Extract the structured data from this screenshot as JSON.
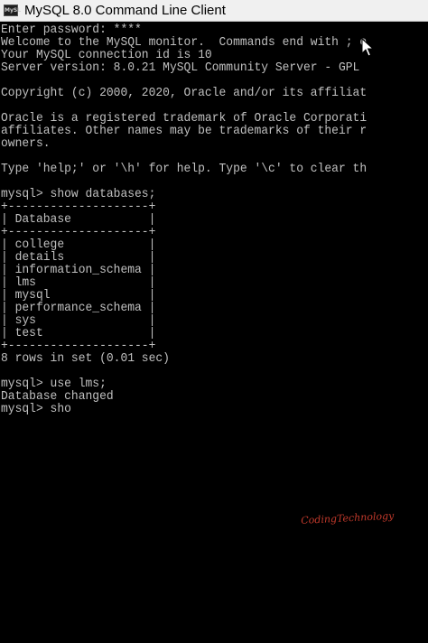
{
  "window": {
    "title": "MySQL 8.0 Command Line Client",
    "icon_label": "MySL",
    "icon": "mysql-console-icon"
  },
  "console": {
    "lines": [
      "Enter password: ****",
      "Welcome to the MySQL monitor.  Commands end with ; o",
      "Your MySQL connection id is 10",
      "Server version: 8.0.21 MySQL Community Server - GPL",
      "",
      "Copyright (c) 2000, 2020, Oracle and/or its affiliat",
      "",
      "Oracle is a registered trademark of Oracle Corporati",
      "affiliates. Other names may be trademarks of their r",
      "owners.",
      "",
      "Type 'help;' or '\\h' for help. Type '\\c' to clear th",
      "",
      "mysql> show databases;",
      "+--------------------+",
      "| Database           |",
      "+--------------------+",
      "| college            |",
      "| details            |",
      "| information_schema |",
      "| lms                |",
      "| mysql              |",
      "| performance_schema |",
      "| sys                |",
      "| test               |",
      "+--------------------+",
      "8 rows in set (0.01 sec)",
      "",
      "mysql> use lms;",
      "Database changed",
      "mysql> sho"
    ]
  },
  "watermark": "CodingTechnology",
  "colors": {
    "console_bg": "#000000",
    "console_text": "#c0c0c0",
    "titlebar_bg": "#f0f0f0",
    "watermark": "#c0392b"
  }
}
